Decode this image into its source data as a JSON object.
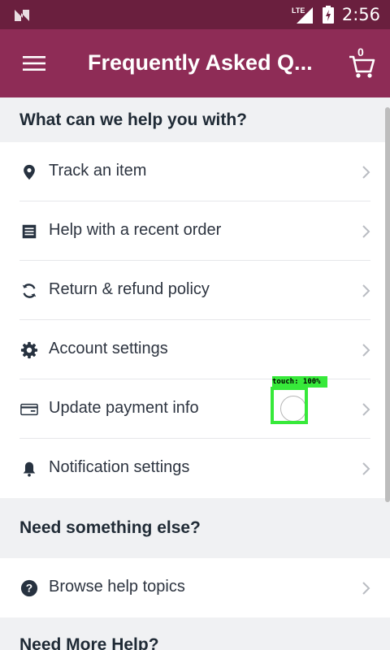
{
  "status_bar": {
    "time": "2:56",
    "network": "LTE"
  },
  "app_bar": {
    "title": "Frequently Asked Q...",
    "cart_count": "0"
  },
  "section1": {
    "header": "What can we help you with?",
    "items": [
      {
        "label": "Track an item",
        "icon": "location-pin-icon"
      },
      {
        "label": "Help with a recent order",
        "icon": "receipt-icon"
      },
      {
        "label": "Return & refund policy",
        "icon": "refresh-icon"
      },
      {
        "label": "Account settings",
        "icon": "gear-icon"
      },
      {
        "label": "Update payment info",
        "icon": "credit-card-icon"
      },
      {
        "label": "Notification settings",
        "icon": "bell-icon"
      }
    ]
  },
  "section2": {
    "header": "Need something else?",
    "items": [
      {
        "label": "Browse help topics",
        "icon": "question-circle-icon"
      }
    ]
  },
  "section3": {
    "header": "Need More Help?"
  },
  "touch_overlay": {
    "label": "touch: 100%"
  }
}
